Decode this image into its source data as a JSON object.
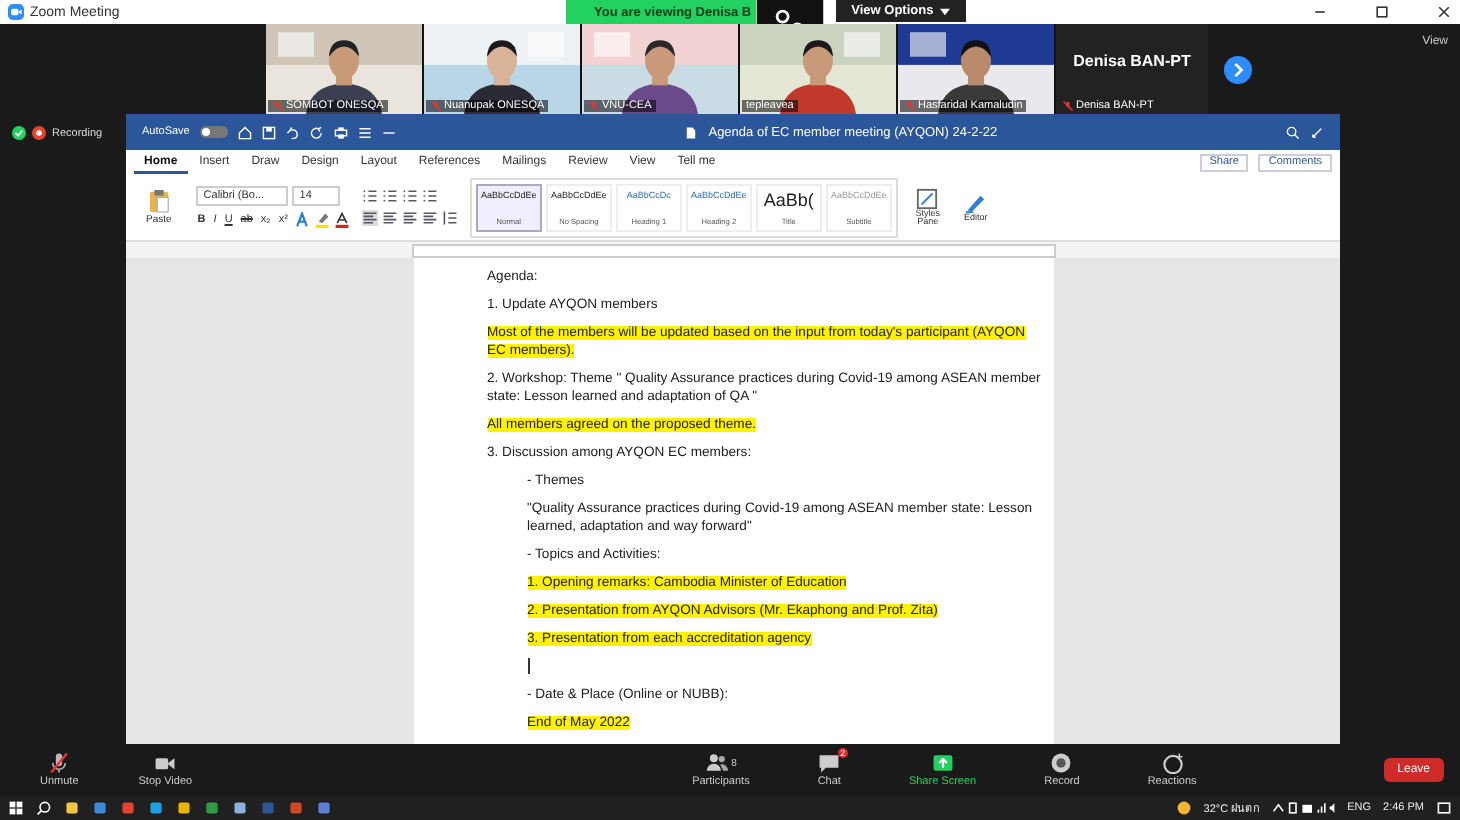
{
  "window": {
    "title": "Zoom Meeting"
  },
  "banner": {
    "text": "You are viewing Denisa B",
    "button": "View Options"
  },
  "participants": [
    {
      "name": "SOMBOT ONESQA",
      "muted": true
    },
    {
      "name": "Nuanupak ONESQA",
      "muted": true
    },
    {
      "name": "VNU-CEA",
      "muted": true
    },
    {
      "name": "tepleavea",
      "muted": false
    },
    {
      "name": "Hasfaridal Kamaludin",
      "muted": true
    }
  ],
  "speaker": {
    "title": "Denisa BAN-PT",
    "name": "Denisa BAN-PT",
    "muted": true
  },
  "view_button": "View",
  "recording": "Recording",
  "word": {
    "autosave": "AutoSave",
    "autosave_on": false,
    "title": "Agenda of EC member meeting (AYQON) 24-2-22",
    "tabs": [
      {
        "label": "Home",
        "selected": true
      },
      {
        "label": "Insert",
        "selected": false
      },
      {
        "label": "Draw",
        "selected": false
      },
      {
        "label": "Design",
        "selected": false
      },
      {
        "label": "Layout",
        "selected": false
      },
      {
        "label": "References",
        "selected": false
      },
      {
        "label": "Mailings",
        "selected": false
      },
      {
        "label": "Review",
        "selected": false
      },
      {
        "label": "View",
        "selected": false
      },
      {
        "label": "Tell me",
        "selected": false
      }
    ],
    "share": "Share",
    "comments": "Comments",
    "paste": "Paste",
    "font": "Calibri (Bo...",
    "size": "14",
    "format_buttons": [
      "B",
      "I",
      "U",
      "ab",
      "x₂",
      "x²"
    ],
    "styles": [
      {
        "preview": "AaBbCcDdEe",
        "name": "Normal",
        "selected": true,
        "kind": "normal"
      },
      {
        "preview": "AaBbCcDdEe",
        "name": "No Spacing",
        "selected": false,
        "kind": "normal"
      },
      {
        "preview": "AaBbCcDc",
        "name": "Heading 1",
        "selected": false,
        "kind": "heading"
      },
      {
        "preview": "AaBbCcDdEe",
        "name": "Heading 2",
        "selected": false,
        "kind": "heading"
      },
      {
        "preview": "AaBb(",
        "name": "Title",
        "selected": false,
        "kind": "title"
      },
      {
        "preview": "AaBbCcDdEe",
        "name": "Subtitle",
        "selected": false,
        "kind": "subtle"
      }
    ],
    "styles_pane": "Styles Pane",
    "editor": "Editor"
  },
  "document": {
    "paragraphs": [
      {
        "kind": "text",
        "text": "Agenda:",
        "highlight": false
      },
      {
        "kind": "text",
        "text": "1. Update AYQON members",
        "highlight": false
      },
      {
        "kind": "text",
        "text": "Most of the members will be updated based on the input from today's participant (AYQON EC members).",
        "highlight": true
      },
      {
        "kind": "text",
        "text": "2. Workshop: Theme \" Quality Assurance practices during Covid-19 among ASEAN member state: Lesson learned and adaptation of QA \"",
        "highlight": false
      },
      {
        "kind": "text",
        "text": "All members agreed on the proposed theme.",
        "highlight": true
      },
      {
        "kind": "text",
        "text": "3. Discussion among AYQON EC members:",
        "highlight": false,
        "children": [
          {
            "kind": "text",
            "text": "- Themes",
            "highlight": false
          },
          {
            "kind": "text",
            "text": "\"Quality Assurance practices during Covid-19 among ASEAN member state: Lesson learned, adaptation and way forward\"",
            "highlight": false
          },
          {
            "kind": "text",
            "text": "- Topics and Activities:",
            "highlight": false
          },
          {
            "kind": "text",
            "text": "1. Opening remarks: Cambodia Minister of Education",
            "highlight": true
          },
          {
            "kind": "text",
            "text": "2. Presentation from AYQON Advisors (Mr. Ekaphong and Prof. Zita)",
            "highlight": true
          },
          {
            "kind": "text",
            "text": "3. Presentation from each accreditation agency",
            "highlight": true
          },
          {
            "kind": "cursor"
          },
          {
            "kind": "text",
            "text": "- Date & Place (Online or NUBB):",
            "highlight": false
          },
          {
            "kind": "text",
            "text": "End of May 2022",
            "highlight": true
          }
        ]
      }
    ]
  },
  "toolbar": {
    "items": [
      {
        "kind": "unmute",
        "label": "Unmute"
      },
      {
        "kind": "video",
        "label": "Stop Video"
      },
      {
        "kind": "participants",
        "label": "Participants",
        "count": "8"
      },
      {
        "kind": "chat",
        "label": "Chat",
        "badge": "2"
      },
      {
        "kind": "share",
        "label": "Share Screen"
      },
      {
        "kind": "record",
        "label": "Record"
      },
      {
        "kind": "reactions",
        "label": "Reactions"
      }
    ],
    "leave": "Leave"
  },
  "taskbar": {
    "weather": "32°C ฝนตก",
    "language": "ENG",
    "time": "2:46 PM"
  }
}
